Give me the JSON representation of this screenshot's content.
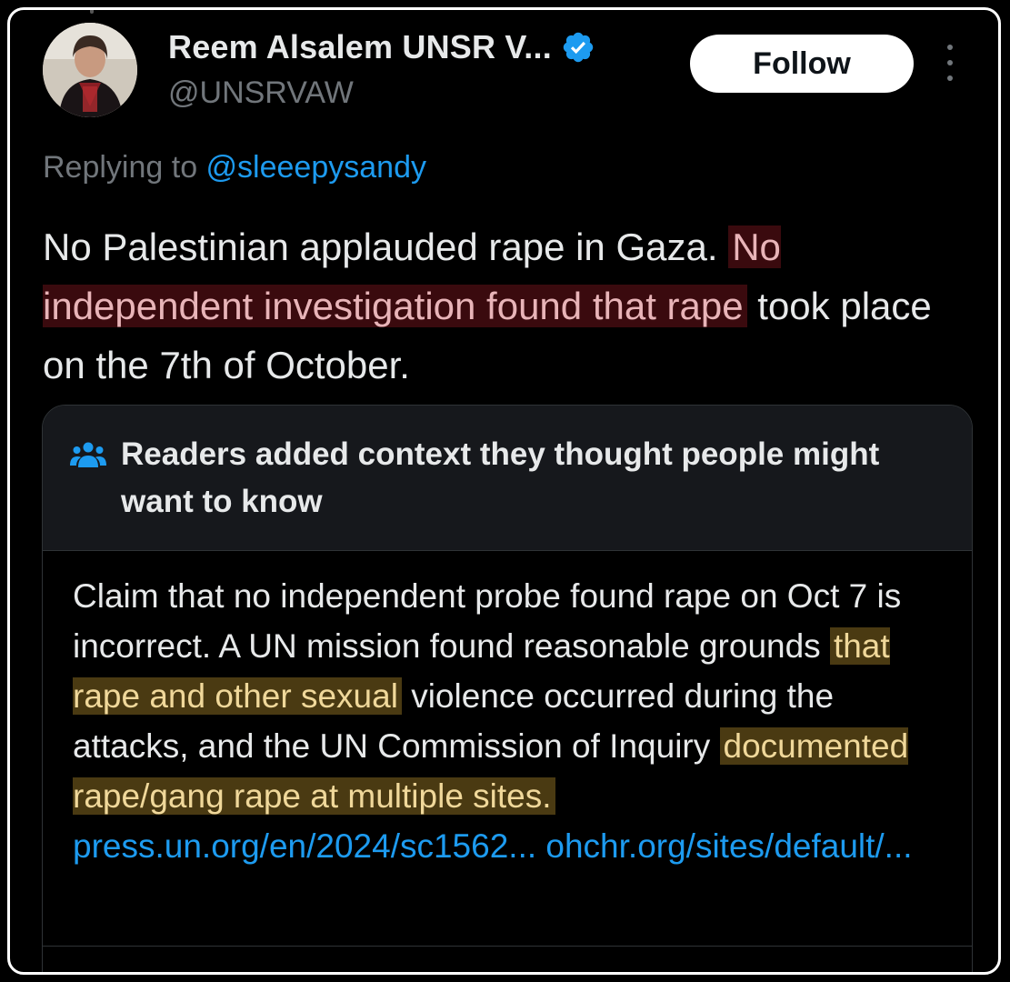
{
  "post": {
    "author_name": "Reem Alsalem UNSR V...",
    "handle": "@UNSRVAW",
    "follow_label": "Follow",
    "replying_prefix": "Replying to ",
    "replying_to": "@sleeepysandy",
    "text_part1": "No Palestinian applauded rape in Gaza. ",
    "text_highlight": "No independent investigation found that rape",
    "text_part2": " took place on the 7th of October."
  },
  "note": {
    "title": "Readers added context they thought people might want to know",
    "body_part1": "Claim that no independent probe found rape on Oct 7 is incorrect. A UN mission found reasonable grounds ",
    "highlight1": "that rape and other sexual",
    "body_part2": " violence occurred during the attacks, and the UN Commission of Inquiry ",
    "highlight2": "documented rape/gang rape at multiple sites.",
    "link1": "press.un.org/en/2024/sc1562...",
    "link2": "ohchr.org/sites/default/..."
  },
  "colors": {
    "background": "#000000",
    "text": "#e7e9ea",
    "muted": "#71767b",
    "link": "#1d9bf0",
    "verified": "#1d9bf0",
    "red_highlight": "#3a0a0e",
    "gold_highlight": "#4a3a12"
  },
  "icons": {
    "verified": "verified-badge-icon",
    "more": "more-vertical-icon",
    "community_notes": "people-group-icon"
  }
}
